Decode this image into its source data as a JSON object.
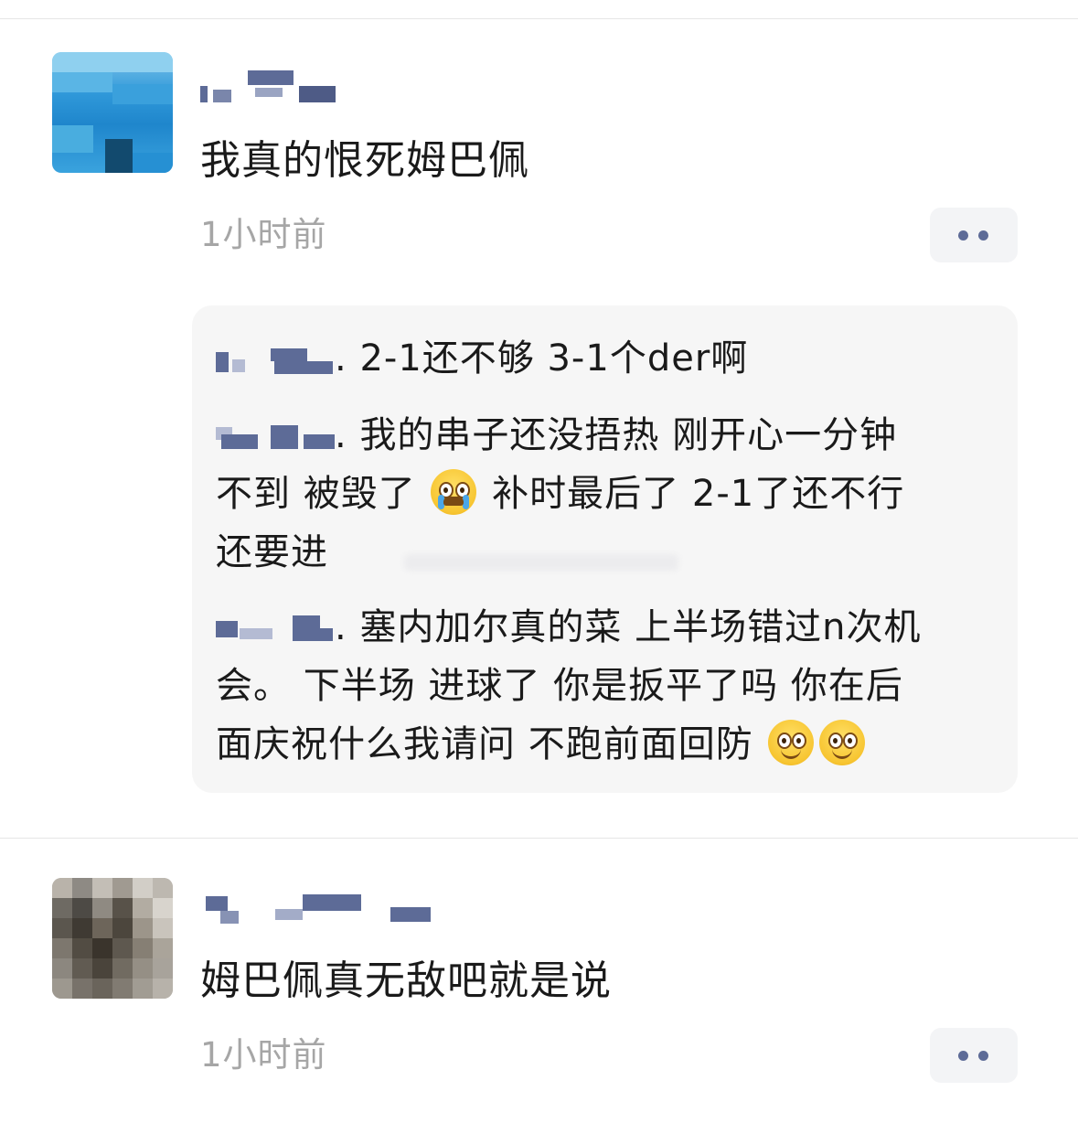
{
  "comments": [
    {
      "text": "我真的恨死姆巴佩",
      "time": "1小时前",
      "replies": [
        {
          "sep": ". ",
          "text": "2-1还不够 3-1个der啊"
        },
        {
          "sep": ". ",
          "text": "我的串子还没捂热  刚开心一分钟",
          "line2_a": "不到  被毁了 ",
          "line2_b": " 补时最后了 2-1了还不行",
          "line3": "还要进"
        },
        {
          "sep": ". ",
          "text": "塞内加尔真的菜 上半场错过n次机",
          "line2": "会。 下半场 进球了 你是扳平了吗  你在后",
          "line3": "面庆祝什么我请问 不跑前面回防 "
        }
      ]
    },
    {
      "text": "姆巴佩真无敌吧就是说",
      "time": "1小时前"
    }
  ],
  "icons": {
    "more": "more-dots-icon",
    "crying_emoji": "loudly-crying-face-icon",
    "smile_emoji": "smiling-face-icon"
  },
  "colors": {
    "nickname": "#5d6b97",
    "time": "#a6a6a6",
    "reply_bg": "#f6f6f6"
  }
}
